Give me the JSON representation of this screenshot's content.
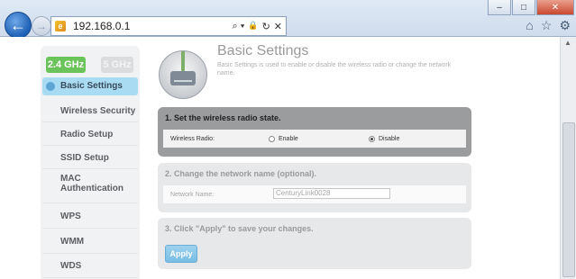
{
  "browser": {
    "address_url": "192.168.0.1",
    "search_glyph": "⌕ ▾",
    "lock_glyph": "🔒",
    "refresh_glyph": "↻",
    "stop_glyph": "✕",
    "min_glyph": "–",
    "max_glyph": "□",
    "close_glyph": "✕",
    "home_glyph": "⌂",
    "star_glyph": "☆",
    "gear_glyph": "⚙",
    "back_glyph": "←",
    "forward_glyph": "→"
  },
  "sidebar": {
    "band_24": "2.4 GHz",
    "band_5": "5 GHz",
    "items": [
      {
        "label": "Basic Settings",
        "active": true
      },
      {
        "label": "Wireless Security"
      },
      {
        "label": "Radio Setup"
      },
      {
        "label": "SSID Setup"
      },
      {
        "label": "MAC Authentication"
      },
      {
        "label": "WPS"
      },
      {
        "label": "WMM"
      },
      {
        "label": "WDS"
      }
    ]
  },
  "header": {
    "title": "Basic Settings",
    "description": "Basic Settings is used to enable or disable the wireless radio or change the network name."
  },
  "step1": {
    "heading": "1. Set the wireless radio state.",
    "label": "Wireless Radio:",
    "option_enable": "Enable",
    "option_disable": "Disable",
    "selected": "Disable"
  },
  "step2": {
    "heading": "2. Change the network name (optional).",
    "label": "Network Name:",
    "value": "CenturyLink0028"
  },
  "step3": {
    "heading": "3. Click \"Apply\" to save your changes.",
    "apply_label": "Apply"
  },
  "colors": {
    "active_band": "#6bc45a",
    "active_item": "#a9dcf3",
    "apply_button": "#78bde5",
    "step1_panel": "#9a9c9e"
  }
}
